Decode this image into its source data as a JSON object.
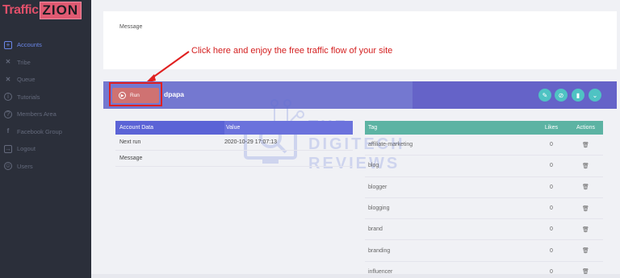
{
  "brand": {
    "part1": "Traffic",
    "part2": "ZION"
  },
  "sidebar": {
    "items": [
      {
        "label": "Accounts",
        "icon": "plus-box-icon",
        "glyph": "+",
        "active": true
      },
      {
        "label": "Tribe",
        "icon": "tribe-icon",
        "glyph": "✕",
        "active": false
      },
      {
        "label": "Queue",
        "icon": "queue-icon",
        "glyph": "✕",
        "active": false
      },
      {
        "label": "Tutorials",
        "icon": "info-icon",
        "glyph": "i",
        "active": false
      },
      {
        "label": "Members Area",
        "icon": "question-icon",
        "glyph": "?",
        "active": false
      },
      {
        "label": "Facebook Group",
        "icon": "facebook-icon",
        "glyph": "f",
        "active": false
      },
      {
        "label": "Logout",
        "icon": "logout-icon",
        "glyph": "→",
        "active": false
      },
      {
        "label": "Users",
        "icon": "user-icon",
        "glyph": "☺",
        "active": false
      }
    ]
  },
  "message_card": {
    "label": "Message"
  },
  "callout": {
    "text": "Click here and enjoy the free traffic flow of your site"
  },
  "account": {
    "run_label": "Run",
    "name": "dpapa",
    "actions": [
      {
        "name": "edit-icon",
        "glyph": "✎"
      },
      {
        "name": "link-icon",
        "glyph": "⊘"
      },
      {
        "name": "delete-icon",
        "glyph": "▮"
      },
      {
        "name": "chevron-down-icon",
        "glyph": "⌄"
      }
    ]
  },
  "account_table": {
    "headers": [
      "Account Data",
      "Value"
    ],
    "rows": [
      {
        "key": "Next run",
        "value": "2020-10-29 17:07:13"
      },
      {
        "key": "Message",
        "value": ""
      }
    ]
  },
  "tags_table": {
    "headers": {
      "tag": "Tag",
      "likes": "Likes",
      "actions": "Actions"
    },
    "rows": [
      {
        "tag": "affiliate-marketing",
        "likes": "0"
      },
      {
        "tag": "blog",
        "likes": "0"
      },
      {
        "tag": "blogger",
        "likes": "0"
      },
      {
        "tag": "blogging",
        "likes": "0"
      },
      {
        "tag": "brand",
        "likes": "0"
      },
      {
        "tag": "branding",
        "likes": "0"
      },
      {
        "tag": "influencer",
        "likes": "0"
      }
    ],
    "delete_glyph": "🗑"
  },
  "watermark": {
    "line1": "THE",
    "line2": "DIGITECH",
    "line3": "REVIEWS"
  },
  "colors": {
    "sidebar_bg": "#2b2f3a",
    "active_nav": "#6a86e8",
    "account_header": "#7478d0",
    "table_header_left": "#5b63d6",
    "table_header_right": "#5cb3a3",
    "action_buttons": "#4fc3c3",
    "highlight_red": "#e02020"
  }
}
